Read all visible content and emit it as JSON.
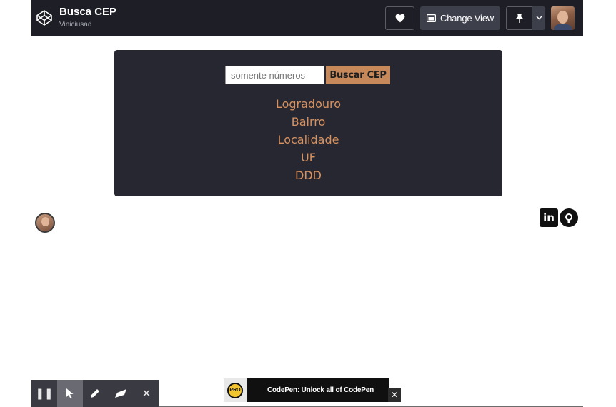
{
  "header": {
    "pen_title": "Busca CEP",
    "author": "Viniciusad",
    "change_view_label": "Change View"
  },
  "search": {
    "placeholder": "somente números",
    "button_label": "Buscar CEP"
  },
  "results": {
    "logradouro": "Logradouro",
    "bairro": "Bairro",
    "localidade": "Localidade",
    "uf": "UF",
    "ddd": "DDD"
  },
  "social": {
    "linkedin_label": "in"
  },
  "promo": {
    "badge": "PRO",
    "text": "CodePen: Unlock all of CodePen",
    "close": "✕"
  },
  "toolbar": {
    "pause": "❚❚",
    "close": "✕"
  },
  "icons": [
    "codepen-logo-icon",
    "heart-icon",
    "change-view-icon",
    "pin-icon",
    "chevron-down-icon",
    "linkedin-icon",
    "github-icon",
    "pause-icon",
    "pointer-icon",
    "pencil-icon",
    "eraser-icon",
    "close-icon"
  ],
  "colors": {
    "header_bg": "#1e1f26",
    "card_bg": "#272731",
    "accent": "#c8895a",
    "result_text": "#d7925f"
  }
}
